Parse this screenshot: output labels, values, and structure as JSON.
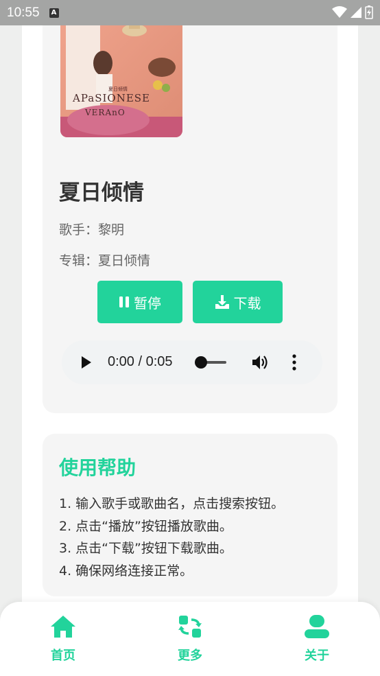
{
  "status_bar": {
    "time": "10:55",
    "notification_glyph": "A"
  },
  "player": {
    "title": "夏日倾情",
    "artist_line": "歌手：黎明",
    "album_line": "专辑：夏日倾情",
    "pause_label": "暂停",
    "download_label": "下载",
    "audio": {
      "time": "0:00 / 0:05",
      "progress": 0
    }
  },
  "cover_art": {
    "text_main": "APaSIONESE",
    "text_sub": "VERAnO",
    "text_title": "夏日倾情"
  },
  "help": {
    "title": "使用帮助",
    "items": [
      "1. 输入歌手或歌曲名，点击搜索按钮。",
      "2. 点击“播放”按钮播放歌曲。",
      "3. 点击“下载”按钮下载歌曲。",
      "4. 确保网络连接正常。"
    ]
  },
  "nav": {
    "home": "首页",
    "more": "更多",
    "about": "关于"
  },
  "colors": {
    "accent": "#22d39b",
    "card": "#f5f5f5",
    "status_bar": "#a4a5a4"
  }
}
